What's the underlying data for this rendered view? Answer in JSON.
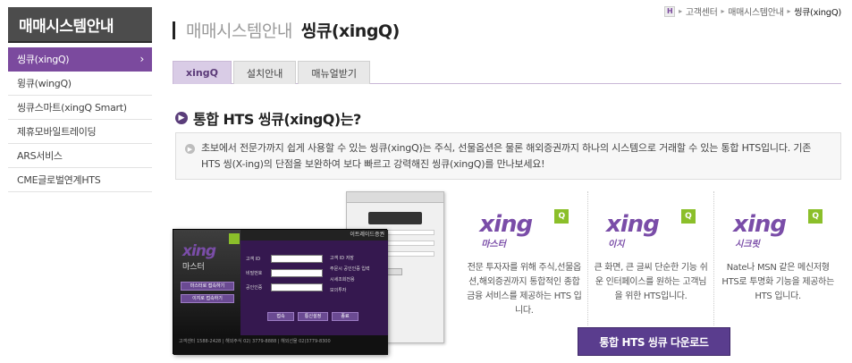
{
  "sidebar": {
    "title": "매매시스템안내",
    "items": [
      {
        "label": "씽큐(xingQ)",
        "active": true
      },
      {
        "label": "윙큐(wingQ)"
      },
      {
        "label": "씽큐스마트(xingQ Smart)"
      },
      {
        "label": "제휴모바일트레이딩"
      },
      {
        "label": "ARS서비스"
      },
      {
        "label": "CME글로벌연계HTS"
      }
    ],
    "active_arrow": "›"
  },
  "breadcrumb": {
    "home_icon": "H",
    "items": [
      "고객센터",
      "매매시스템안내",
      "씽큐(xingQ)"
    ]
  },
  "header": {
    "sub": "매매시스템안내",
    "main": "씽큐(xingQ)"
  },
  "tabs": [
    {
      "label": "xingQ",
      "active": true
    },
    {
      "label": "설치안내"
    },
    {
      "label": "매뉴얼받기"
    }
  ],
  "section": {
    "title": "통합 HTS 씽큐(xingQ)는?"
  },
  "description": "초보에서 전문가까지 쉽게 사용할 수 있는 씽큐(xingQ)는 주식, 선물옵션은 물론 해외증권까지 하나의 시스템으로 거래할 수 있는 통합 HTS입니다. 기존 HTS 씽(X-ing)의 단점을 보완하여 보다 빠르고 강력해진 씽큐(xingQ)를 만나보세요!",
  "screenshot": {
    "logo": "xing",
    "logo_sub": "마스터",
    "brand": "이트레이드증권",
    "btn_master": "마스터로 접속하기",
    "btn_easy": "이지로 접속하기",
    "fields": [
      "고객 ID",
      "비밀번호",
      "공인인증"
    ],
    "checks": [
      "고객 ID 저장",
      "주문시 공인인증 입력",
      "시세조회전용",
      "모의투자"
    ],
    "btn_connect": "접속",
    "btn_settings": "통신설정",
    "btn_exit": "종료",
    "footer": "고객센터 1588-2428 | 해외주식 02) 3779-8888 | 해외선물 02)3779-8300"
  },
  "cards": [
    {
      "logo": "xing",
      "sub": "마스터",
      "desc": "전문 투자자를 위해 주식,선물옵션,해외증권까지 통합적인 종합 금융 서비스를 제공하는 HTS 입니다."
    },
    {
      "logo": "xing",
      "sub": "이지",
      "desc": "큰 화면, 큰 글씨 단순한 기능 쉬운 인터페이스를 원하는 고객님을 위한 HTS입니다."
    },
    {
      "logo": "xing",
      "sub": "시크릿",
      "desc": "Nate나 MSN 같은 메신저형 HTS로 투명화 기능을 제공하는 HTS 입니다."
    }
  ],
  "card_logo_q": "Q",
  "download_button": "통합 HTS 씽큐 다운로드"
}
